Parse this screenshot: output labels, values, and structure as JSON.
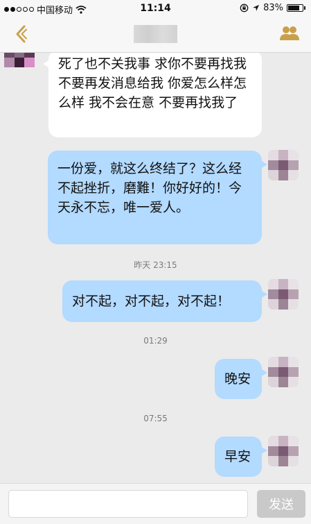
{
  "status_bar": {
    "carrier": "中国移动",
    "time": "11:14",
    "battery": "83%",
    "battery_level": 0.83,
    "signal_bars_filled": 2,
    "signal_bars_total": 5
  },
  "nav": {
    "back_icon": "back-chevron-icon",
    "contacts_icon": "contacts-icon"
  },
  "colors": {
    "accent": "#c9a04a",
    "outgoing_bubble": "#b3daff",
    "incoming_bubble": "#ffffff",
    "background": "#ebebeb"
  },
  "messages": [
    {
      "direction": "incoming",
      "text": "死了也不关我事 求你不要再找我 不要再发消息给我 你爱怎么样怎么样 我不会在意 不要再找我了"
    },
    {
      "direction": "outgoing",
      "text": "一份爱，就这么终结了？这么经不起挫折，磨難！你好好的！今天永不忘，唯一爱人。"
    },
    {
      "timestamp": "昨天 23:15"
    },
    {
      "direction": "outgoing",
      "text": "对不起，对不起，对不起！"
    },
    {
      "timestamp": "01:29"
    },
    {
      "direction": "outgoing",
      "text": "晚安"
    },
    {
      "timestamp": "07:55"
    },
    {
      "direction": "outgoing",
      "text": "早安"
    }
  ],
  "input": {
    "value": "",
    "send_label": "发送"
  }
}
